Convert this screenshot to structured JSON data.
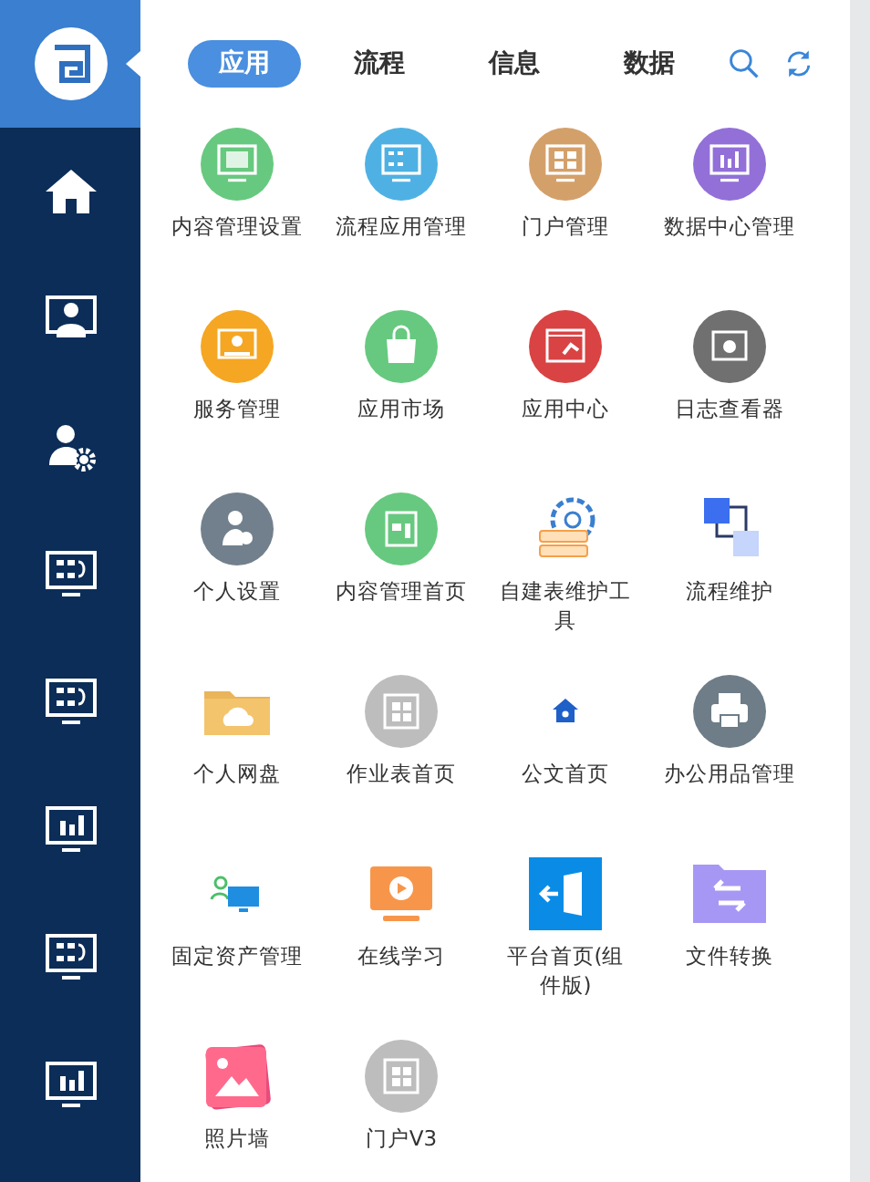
{
  "sidebar": {
    "items": [
      {
        "kind": "home",
        "selected": false
      },
      {
        "kind": "user-monitor",
        "selected": false
      },
      {
        "kind": "user-gear",
        "selected": false
      },
      {
        "kind": "monitor-flow",
        "selected": false
      },
      {
        "kind": "monitor-flow",
        "selected": false
      },
      {
        "kind": "monitor-chart",
        "selected": false
      },
      {
        "kind": "monitor-flow",
        "selected": false
      },
      {
        "kind": "monitor-chart",
        "selected": false
      }
    ]
  },
  "tabs": [
    {
      "label": "应用",
      "selected": true
    },
    {
      "label": "流程",
      "selected": false
    },
    {
      "label": "信息",
      "selected": false
    },
    {
      "label": "数据",
      "selected": false
    }
  ],
  "apps": [
    {
      "label": "内容管理设置",
      "kind": "monitor-doc"
    },
    {
      "label": "流程应用管理",
      "kind": "monitor-flow"
    },
    {
      "label": "门户管理",
      "kind": "monitor-grid"
    },
    {
      "label": "数据中心管理",
      "kind": "monitor-chart"
    },
    {
      "label": "服务管理",
      "kind": "service"
    },
    {
      "label": "应用市场",
      "kind": "bag"
    },
    {
      "label": "应用中心",
      "kind": "app-window"
    },
    {
      "label": "日志查看器",
      "kind": "log"
    },
    {
      "label": "个人设置",
      "kind": "user-gear"
    },
    {
      "label": "内容管理首页",
      "kind": "calendar"
    },
    {
      "label": "自建表维护工具",
      "kind": "gear-server"
    },
    {
      "label": "流程维护",
      "kind": "squares"
    },
    {
      "label": "个人网盘",
      "kind": "folder-cloud"
    },
    {
      "label": "作业表首页",
      "kind": "window-grid"
    },
    {
      "label": "公文首页",
      "kind": "house-small"
    },
    {
      "label": "办公用品管理",
      "kind": "printer"
    },
    {
      "label": "固定资产管理",
      "kind": "user-screen"
    },
    {
      "label": "在线学习",
      "kind": "video"
    },
    {
      "label": "平台首页(组件版)",
      "kind": "door"
    },
    {
      "label": "文件转换",
      "kind": "folder-swap"
    },
    {
      "label": "照片墙",
      "kind": "photo"
    },
    {
      "label": "门户V3",
      "kind": "window-grid"
    }
  ]
}
